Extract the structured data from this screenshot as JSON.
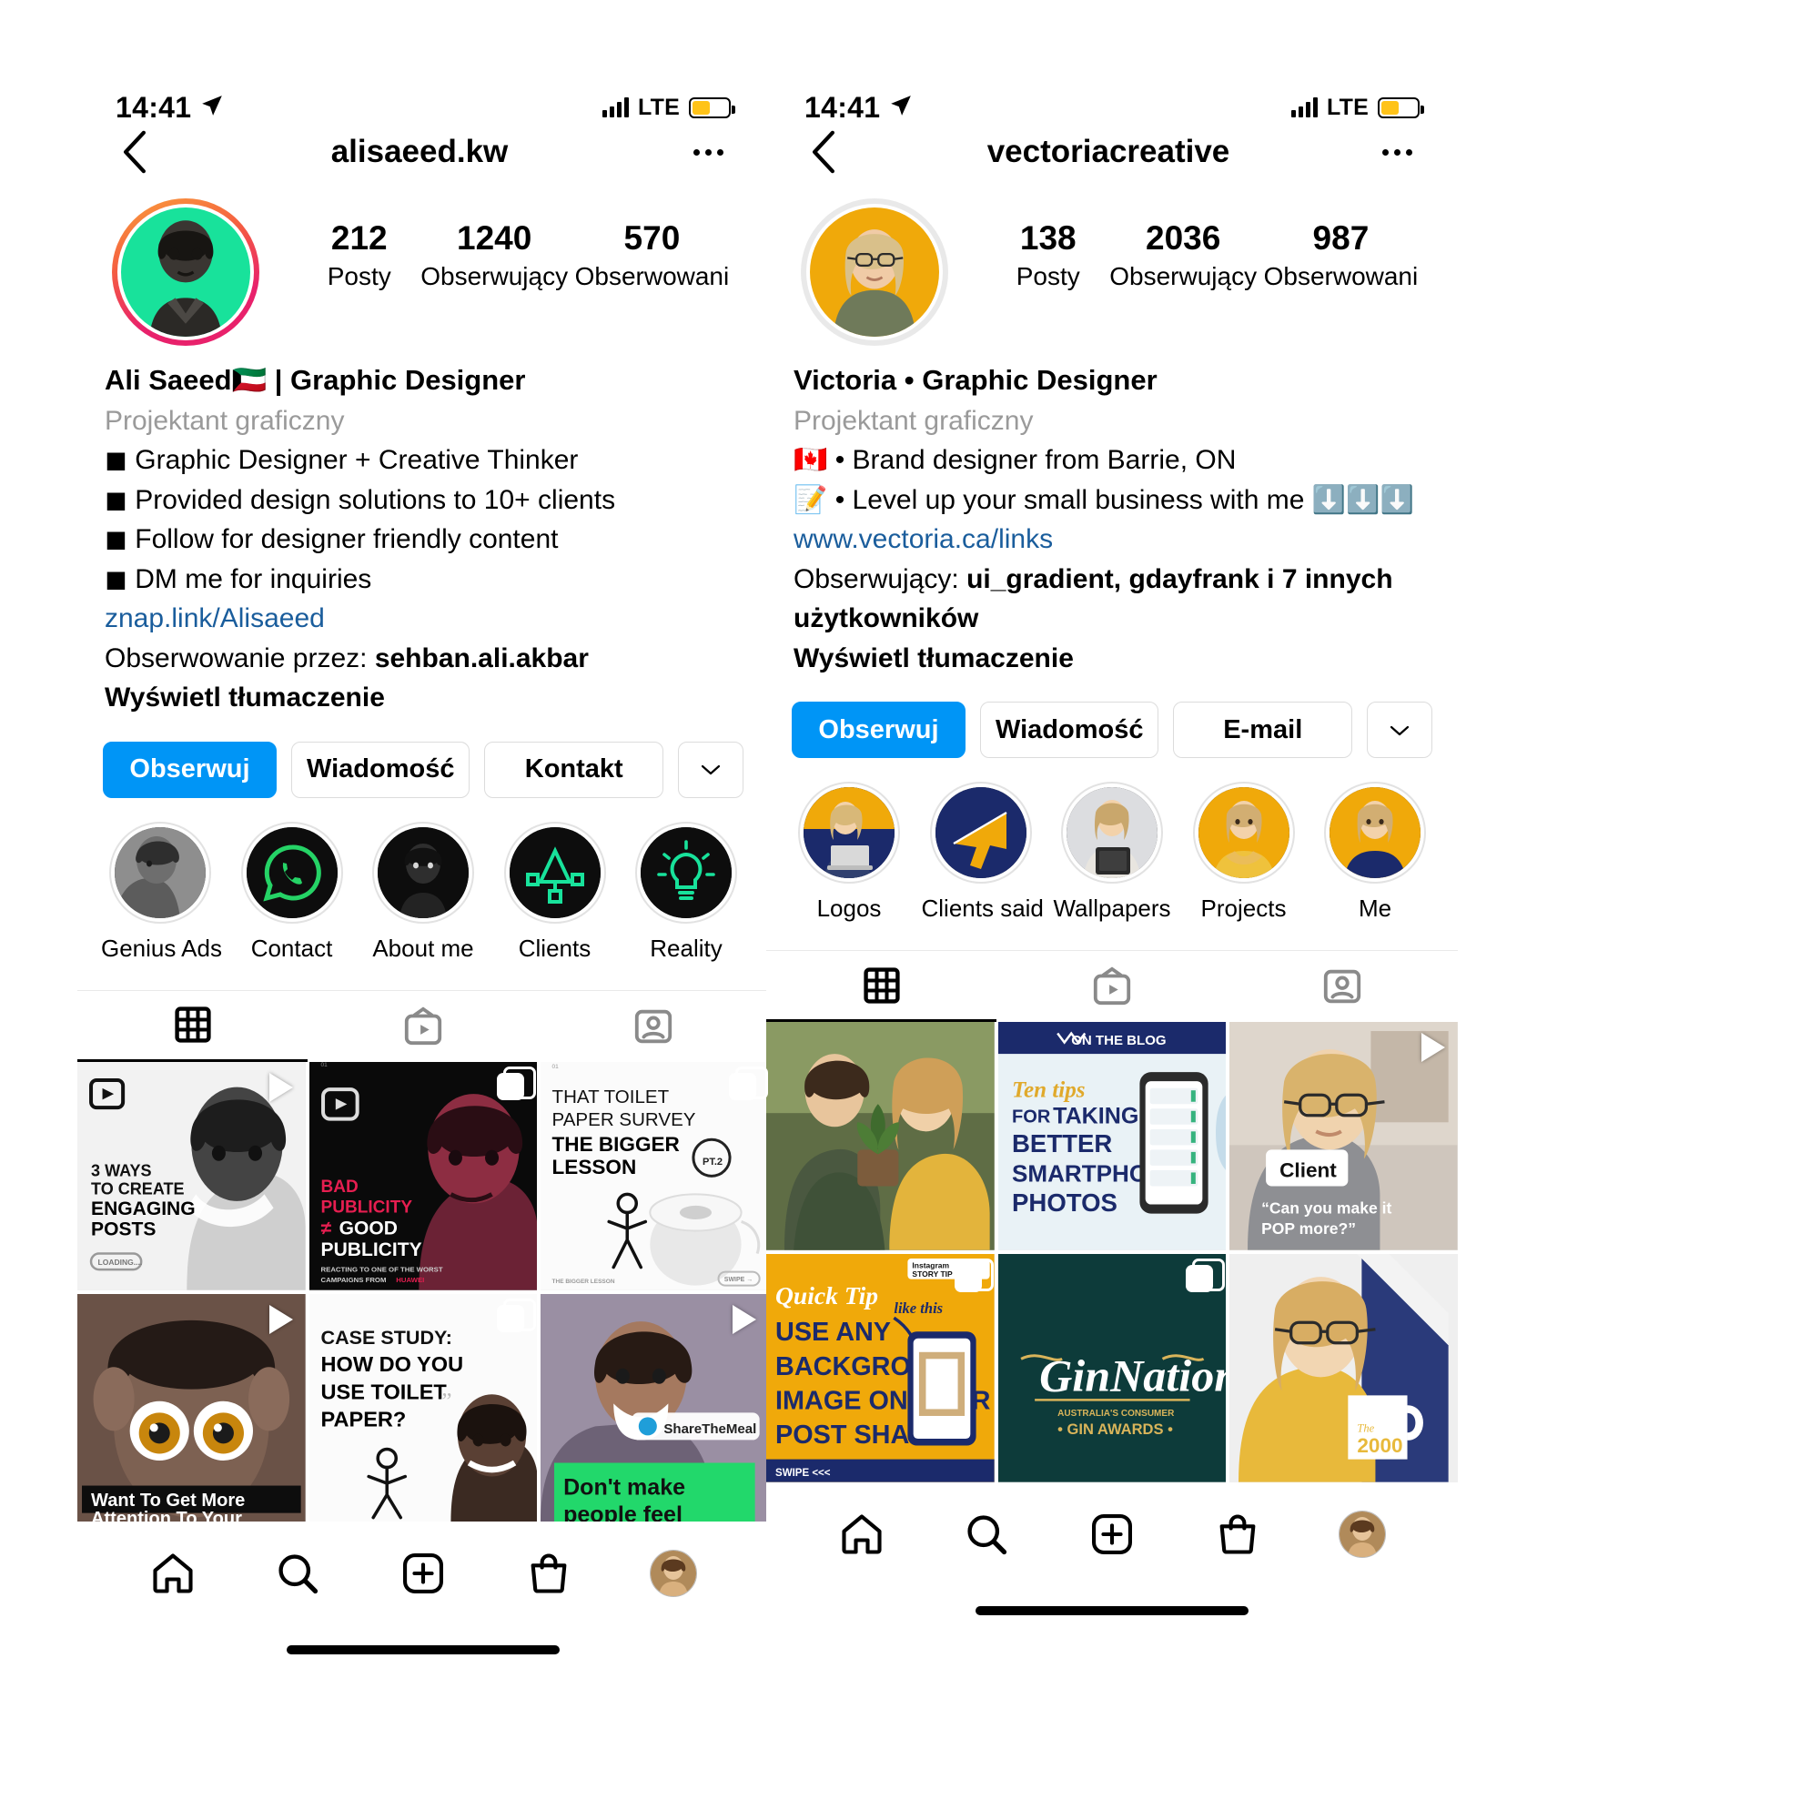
{
  "phones": [
    {
      "id": "left",
      "status": {
        "time": "14:41",
        "network": "LTE",
        "location_icon": "location-arrow-icon"
      },
      "nav": {
        "title": "alisaeed.kw",
        "back_icon": "chevron-left-icon",
        "menu_icon": "more-options-icon"
      },
      "stats": [
        {
          "num": "212",
          "label": "Posty"
        },
        {
          "num": "1240",
          "label": "Obserwujący"
        },
        {
          "num": "570",
          "label": "Obserwowani"
        }
      ],
      "bio": {
        "name": "Ali Saeed🇰🇼 | Graphic Designer",
        "category": "Projektant graficzny",
        "lines": [
          "◼ Graphic Designer + Creative Thinker",
          "◼ Provided design solutions to 10+ clients",
          "◼ Follow for designer friendly content",
          "◼ DM me for inquiries"
        ],
        "link": "znap.link/Alisaeed",
        "followed_by_label": "Obserwowanie przez:",
        "followed_by_names": "sehban.ali.akbar",
        "translate": "Wyświetl tłumaczenie"
      },
      "actions": {
        "follow": "Obserwuj",
        "message": "Wiadomość",
        "third": "Kontakt",
        "chevron_icon": "chevron-down-icon"
      },
      "highlights": [
        {
          "label": "Genius Ads",
          "art": "obama"
        },
        {
          "label": "Contact",
          "art": "whatsapp"
        },
        {
          "label": "About me",
          "art": "portrait"
        },
        {
          "label": "Clients",
          "art": "pen-tool"
        },
        {
          "label": "Reality",
          "art": "lightbulb"
        }
      ],
      "tabs": [
        {
          "icon": "grid-icon",
          "active": true
        },
        {
          "icon": "igtv-icon",
          "active": false
        },
        {
          "icon": "tagged-icon",
          "active": false
        }
      ],
      "posts": [
        {
          "art": "three-ways",
          "badge": "play",
          "title": "3 WAYS TO CREATE ENGAGING POSTS",
          "sub": "LOADING...."
        },
        {
          "art": "bad-publicity",
          "badge": "multi",
          "title": "BAD PUBLICITY ≠ GOOD PUBLICITY",
          "sub": "REACTING TO ONE OF THE WORST CAMPAIGNS FROM HUAWEI"
        },
        {
          "art": "toilet-survey",
          "badge": "multi",
          "title": "THAT TOILET PAPER SURVEY THE BIGGER LESSON",
          "sub": "PT.2"
        },
        {
          "art": "attention",
          "badge": "play",
          "title": "Want To Get More Attention To Your",
          "sub": ""
        },
        {
          "art": "case-study",
          "badge": "multi",
          "title": "CASE STUDY: HOW DO YOU USE TOILET PAPER?",
          "sub": ""
        },
        {
          "art": "sharethemeal",
          "badge": "play",
          "title": "Don't make people feel",
          "sub": "ShareTheMeal"
        }
      ],
      "tabbar": [
        {
          "icon": "home-icon"
        },
        {
          "icon": "search-icon"
        },
        {
          "icon": "add-post-icon"
        },
        {
          "icon": "shop-icon"
        },
        {
          "icon": "profile-avatar-icon"
        }
      ]
    },
    {
      "id": "right",
      "status": {
        "time": "14:41",
        "network": "LTE",
        "location_icon": "location-arrow-icon"
      },
      "nav": {
        "title": "vectoriacreative",
        "back_icon": "chevron-left-icon",
        "menu_icon": "more-options-icon"
      },
      "stats": [
        {
          "num": "138",
          "label": "Posty"
        },
        {
          "num": "2036",
          "label": "Obserwujący"
        },
        {
          "num": "987",
          "label": "Obserwowani"
        }
      ],
      "bio": {
        "name": "Victoria • Graphic Designer",
        "category": "Projektant graficzny",
        "lines": [
          "🇨🇦 • Brand designer from Barrie, ON",
          "📝 • Level up your small business with me ⬇️⬇️⬇️"
        ],
        "link": "www.vectoria.ca/links",
        "followed_by_label": "Obserwujący:",
        "followed_by_names": "ui_gradient, gdayfrank i 7 innych użytkowników",
        "translate": "Wyświetl tłumaczenie"
      },
      "actions": {
        "follow": "Obserwuj",
        "message": "Wiadomość",
        "third": "E-mail",
        "chevron_icon": "chevron-down-icon"
      },
      "highlights": [
        {
          "label": "Logos",
          "art": "laptop-girl"
        },
        {
          "label": "Clients said",
          "art": "megaphone"
        },
        {
          "label": "Wallpapers",
          "art": "tablet-girl"
        },
        {
          "label": "Projects",
          "art": "yellow-girl"
        },
        {
          "label": "Me",
          "art": "yellow-girl2"
        }
      ],
      "tabs": [
        {
          "icon": "grid-icon",
          "active": true
        },
        {
          "icon": "igtv-icon",
          "active": false
        },
        {
          "icon": "tagged-icon",
          "active": false
        }
      ],
      "posts": [
        {
          "art": "couple-tree",
          "badge": "",
          "title": "",
          "sub": ""
        },
        {
          "art": "on-the-blog",
          "badge": "",
          "title": "Ten tips FOR TAKING BETTER SMARTPHONE PHOTOS",
          "sub": "ON THE BLOG"
        },
        {
          "art": "client-pop",
          "badge": "play",
          "title": "Client",
          "sub": "\"Can you make it POP more?\""
        },
        {
          "art": "quick-tip",
          "badge": "multi",
          "title": "USE ANY BACKGROUND IMAGE ON YOUR POST SHARES",
          "sub": "Quick Tip / SWIPE <<<"
        },
        {
          "art": "gin-nation",
          "badge": "multi",
          "title": "GinNation",
          "sub": "• GIN AWARDS •"
        },
        {
          "art": "mug-girl",
          "badge": "",
          "title": "The 2000",
          "sub": ""
        }
      ],
      "tabbar": [
        {
          "icon": "home-icon"
        },
        {
          "icon": "search-icon"
        },
        {
          "icon": "add-post-icon"
        },
        {
          "icon": "shop-icon"
        },
        {
          "icon": "profile-avatar-icon"
        }
      ]
    }
  ],
  "colors": {
    "accent": "#0095F6",
    "link": "#1a5d9c",
    "muted": "#9a9a9a",
    "battery": "#FFC319",
    "notif_dot": "#ED4956",
    "brand_navy": "#1b2a6b",
    "brand_yellow": "#F5B400"
  }
}
